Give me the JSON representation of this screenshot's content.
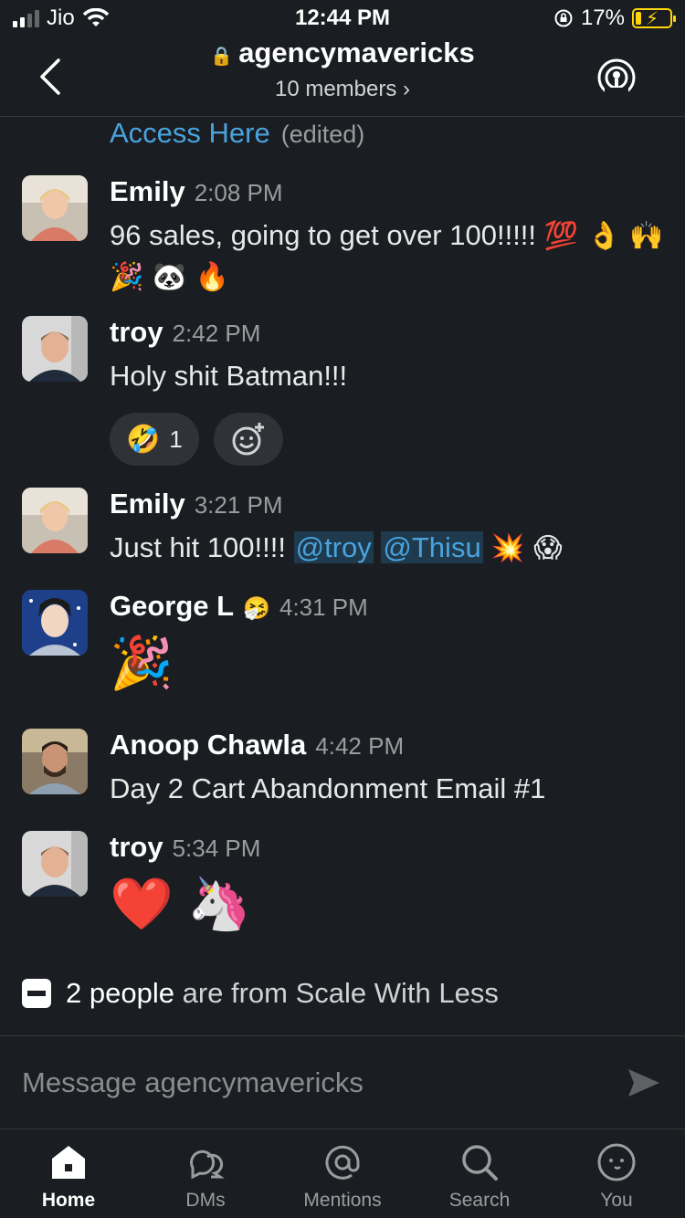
{
  "status_bar": {
    "carrier": "Jio",
    "time": "12:44 PM",
    "battery": "17%"
  },
  "header": {
    "channel_name": "agencymavericks",
    "members": "10 members"
  },
  "messages_area": {
    "edited_link": "Access Here",
    "edited_label": "(edited)"
  },
  "messages": [
    {
      "name": "Emily",
      "time": "2:08 PM",
      "text": "96 sales, going to get over 100!!!!!",
      "emojis": "💯 👌 🙌 🎉 🐼 🔥"
    },
    {
      "name": "troy",
      "time": "2:42 PM",
      "text": "Holy shit Batman!!!",
      "reaction_emoji": "🤣",
      "reaction_count": "1"
    },
    {
      "name": "Emily",
      "time": "3:21 PM",
      "text": "Just hit 100!!!!",
      "mention1": "@troy",
      "mention2": "@Thisu",
      "emojis": "💥 😱"
    },
    {
      "name": "George L",
      "status_emoji": "🤧",
      "time": "4:31 PM",
      "emojis": "🎉"
    },
    {
      "name": "Anoop Chawla",
      "time": "4:42 PM",
      "link": "Day 2 Cart Abandonment Email #1"
    },
    {
      "name": "troy",
      "time": "5:34 PM",
      "emojis": "❤️ 🦄"
    }
  ],
  "people_note": {
    "count": "2 people",
    "rest": "are from Scale With Less"
  },
  "composer": {
    "placeholder": "Message agencymavericks"
  },
  "tabs": [
    {
      "label": "Home"
    },
    {
      "label": "DMs"
    },
    {
      "label": "Mentions"
    },
    {
      "label": "Search"
    },
    {
      "label": "You"
    }
  ]
}
